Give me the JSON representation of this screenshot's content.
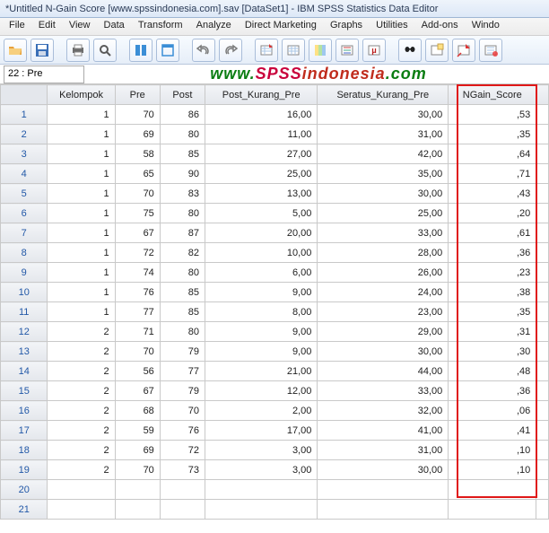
{
  "window": {
    "title": "*Untitled N-Gain Score [www.spssindonesia.com].sav [DataSet1] - IBM SPSS Statistics Data Editor"
  },
  "menu": [
    "File",
    "Edit",
    "View",
    "Data",
    "Transform",
    "Analyze",
    "Direct Marketing",
    "Graphs",
    "Utilities",
    "Add-ons",
    "Windo"
  ],
  "cellref": {
    "label": "22 : Pre"
  },
  "brand": {
    "p1": "www.",
    "p2": "SPSS",
    "p3": "indonesia",
    "p4": ".com"
  },
  "columns": [
    "Kelompok",
    "Pre",
    "Post",
    "Post_Kurang_Pre",
    "Seratus_Kurang_Pre",
    "NGain_Score"
  ],
  "rows": [
    {
      "n": "1",
      "kel": "1",
      "pre": "70",
      "post": "86",
      "pkp": "16,00",
      "skp": "30,00",
      "ng": ",53"
    },
    {
      "n": "2",
      "kel": "1",
      "pre": "69",
      "post": "80",
      "pkp": "11,00",
      "skp": "31,00",
      "ng": ",35"
    },
    {
      "n": "3",
      "kel": "1",
      "pre": "58",
      "post": "85",
      "pkp": "27,00",
      "skp": "42,00",
      "ng": ",64"
    },
    {
      "n": "4",
      "kel": "1",
      "pre": "65",
      "post": "90",
      "pkp": "25,00",
      "skp": "35,00",
      "ng": ",71"
    },
    {
      "n": "5",
      "kel": "1",
      "pre": "70",
      "post": "83",
      "pkp": "13,00",
      "skp": "30,00",
      "ng": ",43"
    },
    {
      "n": "6",
      "kel": "1",
      "pre": "75",
      "post": "80",
      "pkp": "5,00",
      "skp": "25,00",
      "ng": ",20"
    },
    {
      "n": "7",
      "kel": "1",
      "pre": "67",
      "post": "87",
      "pkp": "20,00",
      "skp": "33,00",
      "ng": ",61"
    },
    {
      "n": "8",
      "kel": "1",
      "pre": "72",
      "post": "82",
      "pkp": "10,00",
      "skp": "28,00",
      "ng": ",36"
    },
    {
      "n": "9",
      "kel": "1",
      "pre": "74",
      "post": "80",
      "pkp": "6,00",
      "skp": "26,00",
      "ng": ",23"
    },
    {
      "n": "10",
      "kel": "1",
      "pre": "76",
      "post": "85",
      "pkp": "9,00",
      "skp": "24,00",
      "ng": ",38"
    },
    {
      "n": "11",
      "kel": "1",
      "pre": "77",
      "post": "85",
      "pkp": "8,00",
      "skp": "23,00",
      "ng": ",35"
    },
    {
      "n": "12",
      "kel": "2",
      "pre": "71",
      "post": "80",
      "pkp": "9,00",
      "skp": "29,00",
      "ng": ",31"
    },
    {
      "n": "13",
      "kel": "2",
      "pre": "70",
      "post": "79",
      "pkp": "9,00",
      "skp": "30,00",
      "ng": ",30"
    },
    {
      "n": "14",
      "kel": "2",
      "pre": "56",
      "post": "77",
      "pkp": "21,00",
      "skp": "44,00",
      "ng": ",48"
    },
    {
      "n": "15",
      "kel": "2",
      "pre": "67",
      "post": "79",
      "pkp": "12,00",
      "skp": "33,00",
      "ng": ",36"
    },
    {
      "n": "16",
      "kel": "2",
      "pre": "68",
      "post": "70",
      "pkp": "2,00",
      "skp": "32,00",
      "ng": ",06"
    },
    {
      "n": "17",
      "kel": "2",
      "pre": "59",
      "post": "76",
      "pkp": "17,00",
      "skp": "41,00",
      "ng": ",41"
    },
    {
      "n": "18",
      "kel": "2",
      "pre": "69",
      "post": "72",
      "pkp": "3,00",
      "skp": "31,00",
      "ng": ",10"
    },
    {
      "n": "19",
      "kel": "2",
      "pre": "70",
      "post": "73",
      "pkp": "3,00",
      "skp": "30,00",
      "ng": ",10"
    },
    {
      "n": "20",
      "kel": "",
      "pre": "",
      "post": "",
      "pkp": "",
      "skp": "",
      "ng": ""
    },
    {
      "n": "21",
      "kel": "",
      "pre": "",
      "post": "",
      "pkp": "",
      "skp": "",
      "ng": ""
    }
  ],
  "highlight": {
    "column": "NGain_Score"
  }
}
